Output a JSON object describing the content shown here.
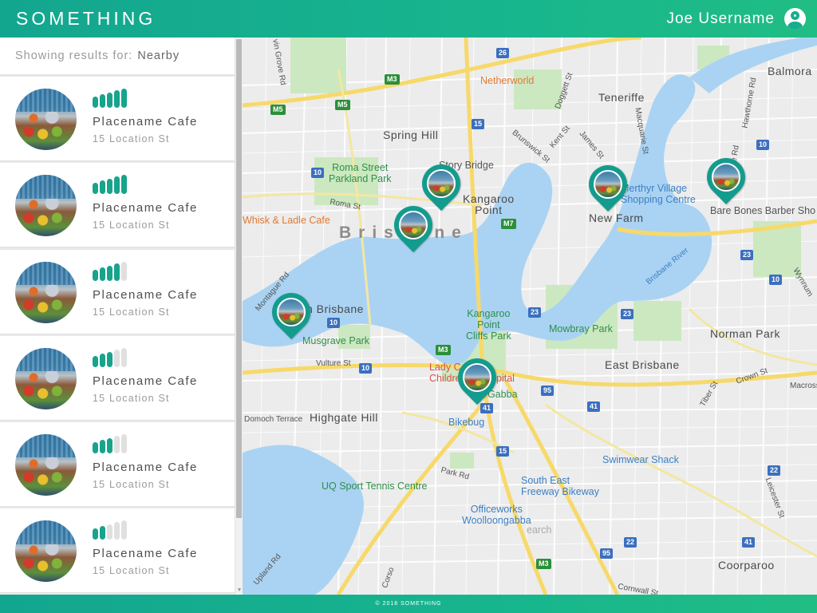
{
  "header": {
    "brand": "SOMETHING",
    "username": "Joe Username",
    "avatar_icon": "user-circle-icon"
  },
  "sidebar": {
    "results_label": "Showing results for:",
    "results_value": "Nearby",
    "places": [
      {
        "name": "Placename Cafe",
        "address": "15 Location St",
        "rating": 5
      },
      {
        "name": "Placename Cafe",
        "address": "15 Location St",
        "rating": 5
      },
      {
        "name": "Placename Cafe",
        "address": "15 Location St",
        "rating": 4
      },
      {
        "name": "Placename Cafe",
        "address": "15 Location St",
        "rating": 3
      },
      {
        "name": "Placename Cafe",
        "address": "15 Location St",
        "rating": 3
      },
      {
        "name": "Placename Cafe",
        "address": "15 Location St",
        "rating": 2
      }
    ],
    "rating_max": 5
  },
  "map": {
    "labels": {
      "netherworld": "Netherworld",
      "teneriffe": "Teneriffe",
      "balmoral": "Balmora",
      "spring_hill": "Spring Hill",
      "story_bridge": "Story Bridge",
      "roma_st": "Roma Street\nParkland Park",
      "kangaroo_point": "Kangaroo\nPoint",
      "merthyr": "Merthyr Village\nShopping Centre",
      "new_farm": "New Farm",
      "bare_bones": "Bare Bones Barber Sho",
      "whisk": "Whisk & Ladle Cafe",
      "brisbane": "Brisbane",
      "south_brisbane": "h Brisbane",
      "musgrave": "Musgrave Park",
      "kp_cliffs": "Kangaroo\nPoint\nCliffs Park",
      "mowbray": "Mowbray Park",
      "norman_park": "Norman Park",
      "east_brisbane": "East Brisbane",
      "lady_cilento": "Lady C\nChildre",
      "hospital": "pital",
      "gabba": "Gabba",
      "highgate": "Highgate Hill",
      "bikebug": "Bikebug",
      "swimwear": "Swimwear Shack",
      "uq_sport": "UQ Sport Tennis Centre",
      "south_east_bikeway": "South East\nFreeway Bikeway",
      "officeworks": "Officeworks\nWoolloongabba",
      "coorparoo": "Coorparoo",
      "brisbane_river": "Brisbane River",
      "vulture_st": "Vulture St",
      "roma_street": "Roma St",
      "montague_rd": "Montague Rd",
      "domoch": "Domoch Terrace",
      "park_rd": "Park Rd",
      "upland_rd": "Upland Rd",
      "cornwall_st": "Cornwall St",
      "crown_st": "Crown St",
      "macross": "Macross",
      "tiber_st": "Tiber St",
      "leicester_st": "Leicester St",
      "wynnum_rd": "Wynnum",
      "hawthorne_rd": "Hawthorne Rd",
      "bowen": "owe Rd",
      "macquarie": "Macquarie St",
      "doggett": "Doggett St",
      "brunswick": "Brunswick St",
      "kent_st": "Kent St",
      "james_st": "James St",
      "grove_rd": "vin Grove Rd",
      "corso": "Corso",
      "search": "earch"
    },
    "shields": {
      "m3a": "M3",
      "m5a": "M5",
      "m5b": "M5",
      "r26": "26",
      "r15a": "15",
      "r10a": "10",
      "r10b": "10",
      "r10c": "10",
      "r10d": "10",
      "r10e": "10",
      "m7": "M7",
      "r23a": "23",
      "r23b": "23",
      "r23c": "23",
      "m3b": "M3",
      "r41a": "41",
      "r41b": "41",
      "r41c": "41",
      "r95a": "95",
      "r95b": "95",
      "r15b": "15",
      "r22a": "22",
      "r22b": "22",
      "m3c": "M3"
    }
  },
  "footer": {
    "copyright": "© 2018 SOMETHING"
  }
}
